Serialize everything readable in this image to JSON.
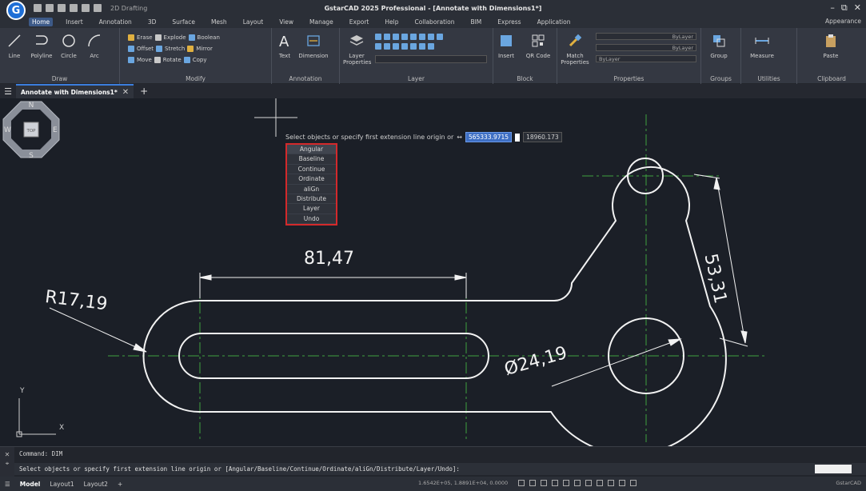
{
  "app": {
    "logo": "G",
    "workspace": "2D Drafting",
    "title": "GstarCAD 2025 Professional - [Annotate with Dimensions1*]",
    "controls": [
      "–",
      "⧉",
      "✕"
    ]
  },
  "ribbon_tabs": [
    "Home",
    "Insert",
    "Annotation",
    "3D",
    "Surface",
    "Mesh",
    "Layout",
    "View",
    "Manage",
    "Export",
    "Help",
    "Collaboration",
    "BIM",
    "Express",
    "Application"
  ],
  "ribbon_tabs_right": "Appearance",
  "ribbon": {
    "draw": {
      "title": "Draw",
      "buttons": [
        "Line",
        "Polyline",
        "Circle",
        "Arc"
      ]
    },
    "modify": {
      "title": "Modify",
      "rows": [
        [
          "Erase",
          "Explode",
          "Boolean"
        ],
        [
          "Offset",
          "Stretch",
          "Mirror"
        ],
        [
          "Move",
          "Rotate",
          "Copy"
        ]
      ]
    },
    "annotation": {
      "title": "Annotation",
      "buttons": [
        "Text",
        "Dimension"
      ]
    },
    "layer": {
      "title": "Layer",
      "button": "Layer Properties"
    },
    "block": {
      "title": "Block",
      "buttons": [
        "Insert",
        "QR Code"
      ]
    },
    "properties": {
      "title": "Properties",
      "button": "Match Properties",
      "bylayer": [
        "ByLayer",
        "ByLayer",
        "ByLayer"
      ]
    },
    "groups": {
      "title": "Groups",
      "button": "Group"
    },
    "utilities": {
      "title": "Utilities",
      "button": "Measure"
    },
    "clipboard": {
      "title": "Clipboard",
      "button": "Paste"
    }
  },
  "document_tab": {
    "label": "Annotate with Dimensions1*",
    "close": "✕",
    "new": "+"
  },
  "prompt": {
    "text": "Select objects or specify first extension line origin or",
    "sep": "↔",
    "coord_x": "565333.9715",
    "coord_y": "18960.173"
  },
  "dim_menu": [
    "Angular",
    "Baseline",
    "Continue",
    "Ordinate",
    "aliGn",
    "Distribute",
    "Layer",
    "Undo"
  ],
  "dimensions": {
    "linear": "81,47",
    "radius": "R17,19",
    "aligned": "53,31",
    "diameter": "Ø24,19"
  },
  "ucs": {
    "x": "X",
    "y": "Y"
  },
  "viewcube": {
    "n": "N",
    "s": "S",
    "w": "W",
    "e": "E",
    "face": "TOP"
  },
  "command": {
    "side_icons": [
      "✕",
      "⌖"
    ],
    "history": "Command: DIM",
    "current": "Select objects or specify first extension line origin or [Angular/Baseline/Continue/Ordinate/aliGn/Distribute/Layer/Undo]:"
  },
  "statusbar": {
    "menu": "☰",
    "tabs": [
      "Model",
      "Layout1",
      "Layout2"
    ],
    "add": "+",
    "coords": "1.6542E+05, 1.8891E+04, 0.0000",
    "right": "GstarCAD"
  }
}
